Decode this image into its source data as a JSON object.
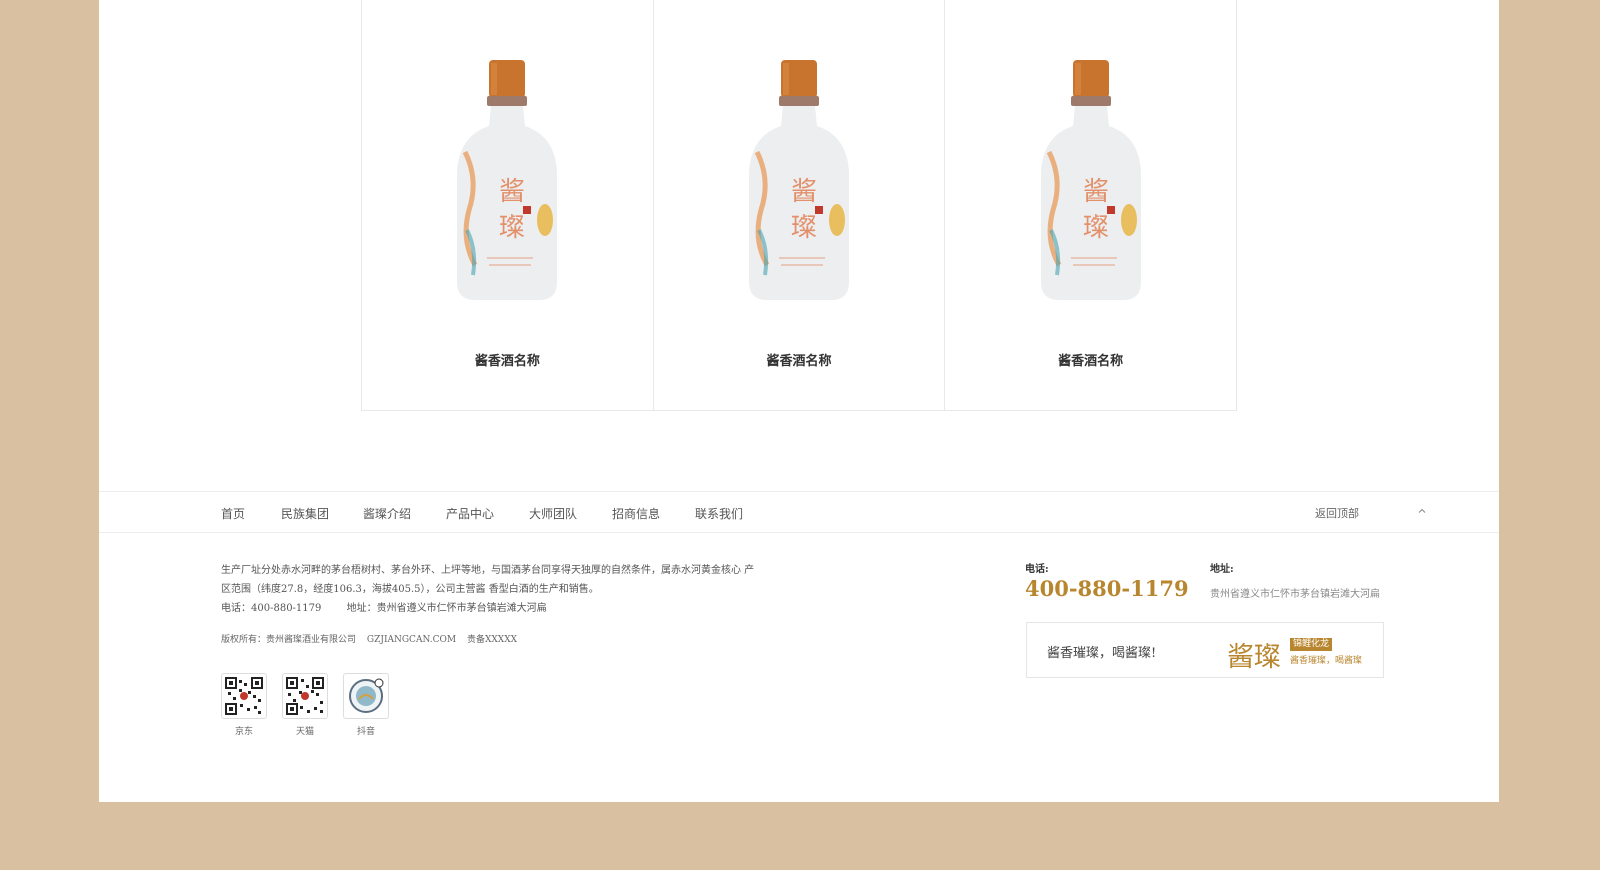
{
  "products": [
    {
      "name": "酱香酒名称",
      "label_char1": "酱",
      "label_char2": "璨"
    },
    {
      "name": "酱香酒名称",
      "label_char1": "酱",
      "label_char2": "璨"
    },
    {
      "name": "酱香酒名称",
      "label_char1": "酱",
      "label_char2": "璨"
    }
  ],
  "nav": {
    "items": [
      "首页",
      "民族集团",
      "酱璨介绍",
      "产品中心",
      "大师团队",
      "招商信息",
      "联系我们"
    ],
    "back_to_top": "返回顶部"
  },
  "footer": {
    "company_intro": "生产厂址分处赤水河畔的茅台梧树村、茅台外环、上坪等地，与国酒茅台同享得天独厚的自然条件，属赤水河黄金核心 产区范围（纬度27.8，经度106.3，海拔405.5），公司主营酱 香型白酒的生产和销售。",
    "phone_line": "电话：400-880-1179",
    "address_line": "地址：贵州省遵义市仁怀市茅台镇岩滩大河扁",
    "copyright": "版权所有：贵州酱璨酒业有限公司",
    "domain": "GZJIANGCAN.COM",
    "icp": "贵备XXXXX",
    "qr_codes": [
      {
        "label": "京东",
        "icon": "qr-code-icon"
      },
      {
        "label": "天猫",
        "icon": "qr-code-icon"
      },
      {
        "label": "抖音",
        "icon": "douyin-logo-icon"
      }
    ],
    "phone_label": "电话:",
    "phone_number": "400-880-1179",
    "addr_label": "地址:",
    "addr_text": "贵州省遵义市仁怀市茅台镇岩滩大河扁",
    "slogan": "酱香璀璨，喝酱璨!",
    "brand_name": "酱璨",
    "brand_tag": "锦鲤化龙",
    "brand_sub": "酱香璀璨，喝酱璨"
  },
  "colors": {
    "background": "#d9c0a0",
    "accent": "#b8862e",
    "cap": "#c8742e"
  }
}
